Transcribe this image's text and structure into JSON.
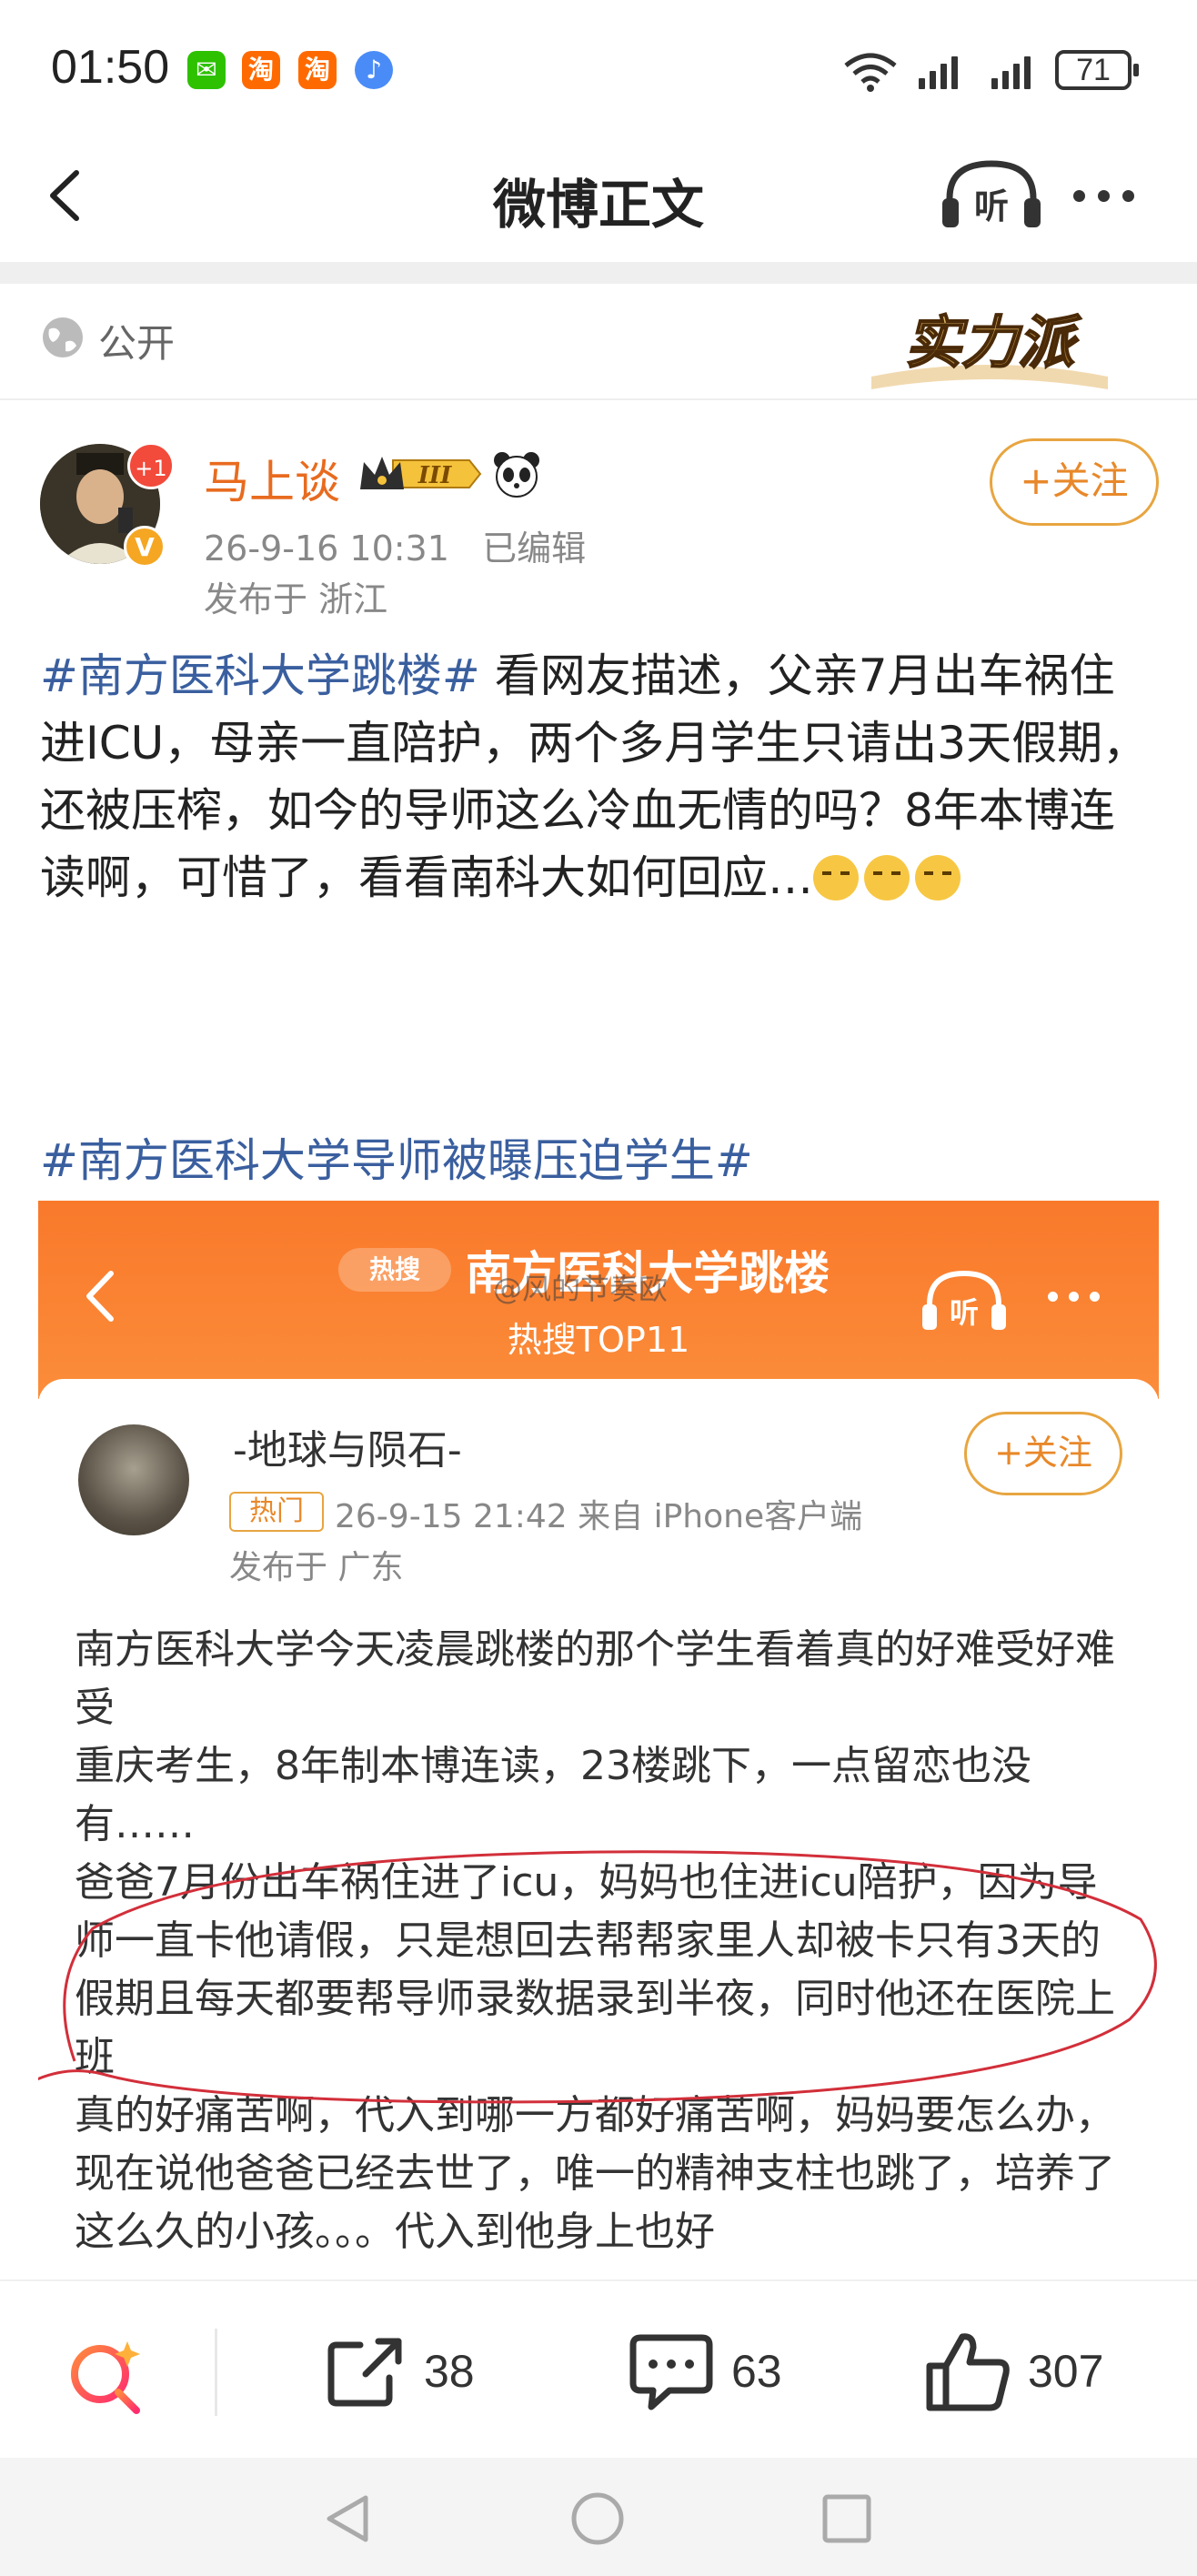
{
  "status_bar": {
    "time": "01:50",
    "apps": [
      "wechat-icon",
      "taobao-icon",
      "taobao-icon",
      "music-icon"
    ],
    "battery": "71"
  },
  "header": {
    "title": "微博正文",
    "listen_label": "听"
  },
  "visibility": {
    "label": "公开",
    "badge_text": "实力派"
  },
  "author": {
    "name": "马上谈",
    "plus_badge": "+1",
    "level": "III",
    "time": "26-9-16 10:31",
    "edited": "已编辑",
    "location": "发布于 浙江",
    "follow_label": "+关注"
  },
  "post": {
    "topic1": "#南方医科大学跳楼#",
    "text": " 看网友描述，父亲7月出车祸住进ICU，母亲一直陪护，两个多月学生只请出3天假期，还被压榨，如今的导师这么冷血无情的吗？8年本博连读啊，可惜了，看看南科大如何回应…",
    "topic2": "#南方医科大学导师被曝压迫学生#"
  },
  "embedded": {
    "hot_pill": "热搜",
    "title": "南方医科大学跳楼",
    "subtitle": "热搜TOP11",
    "watermark": "@风的节奏欧",
    "listen_label": "听",
    "user_name": "-地球与陨石-",
    "hot_tag": "热门",
    "meta": "26-9-15 21:42  来自 iPhone客户端",
    "location": "发布于 广东",
    "follow_label": "+关注",
    "paragraphs": [
      "南方医科大学今天凌晨跳楼的那个学生看着真的好难受好难受",
      "重庆考生，8年制本博连读，23楼跳下，一点留恋也没有……",
      "爸爸7月份出车祸住进了icu，妈妈也住进icu陪护，因为导师一直卡他请假，只是想回去帮帮家里人却被卡只有3天的假期且每天都要帮导师录数据录到半夜，同时他还在医院上班",
      "真的好痛苦啊，代入到哪一方都好痛苦啊，妈妈要怎么办，现在说他爸爸已经去世了，唯一的精神支柱也跳了，培养了这么久的小孩。。。代入到他身上也好"
    ]
  },
  "actions": {
    "share_count": "38",
    "comment_count": "63",
    "like_count": "307"
  }
}
